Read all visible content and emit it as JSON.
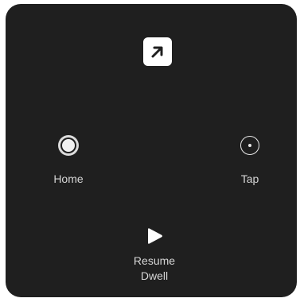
{
  "controls": {
    "top": {
      "icon": "arrow-up-right-icon"
    },
    "home": {
      "label": "Home",
      "icon": "home-button-icon"
    },
    "tap": {
      "label": "Tap",
      "icon": "tap-target-icon"
    },
    "resume": {
      "label": "Resume\nDwell",
      "icon": "play-icon"
    }
  },
  "colors": {
    "panel_background": "#1f1f1f",
    "foreground": "#ffffff",
    "label": "#d6d6d6"
  }
}
